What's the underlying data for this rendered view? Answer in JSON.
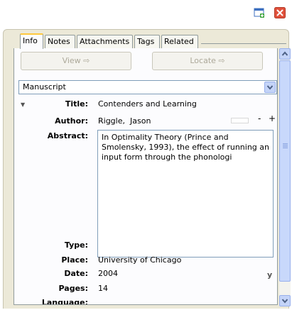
{
  "toolbar": {
    "new_window_icon": "new-window-icon",
    "close_icon": "close-icon"
  },
  "tabs": [
    {
      "label": "Info",
      "active": true
    },
    {
      "label": "Notes",
      "active": false
    },
    {
      "label": "Attachments",
      "active": false
    },
    {
      "label": "Tags",
      "active": false
    },
    {
      "label": "Related",
      "active": false
    }
  ],
  "buttons": {
    "view_label": "View ⇨",
    "locate_label": "Locate ⇨"
  },
  "item_type": {
    "selected": "Manuscript"
  },
  "fields": {
    "title_label": "Title:",
    "title_value": "Contenders and Learning",
    "author_label": "Author:",
    "author_last": "Riggle,",
    "author_first": "Jason",
    "remove_creator": "-",
    "add_creator": "+",
    "abstract_label": "Abstract:",
    "abstract_value": "In Optimality Theory (Prince and Smolensky, 1993), the effect of running an input form through the phonologi",
    "type_label": "Type:",
    "type_value": "",
    "place_label": "Place:",
    "place_value": "University of Chicago",
    "date_label": "Date:",
    "date_value": "2004",
    "date_format": "y",
    "pages_label": "Pages:",
    "pages_value": "14",
    "language_label": "Language:",
    "language_value": ""
  },
  "colors": {
    "panel": "#ece9d8",
    "accent_tab": "#ffc83c",
    "scrollbar": "#c4d4f8",
    "close_red": "#e0513b"
  }
}
